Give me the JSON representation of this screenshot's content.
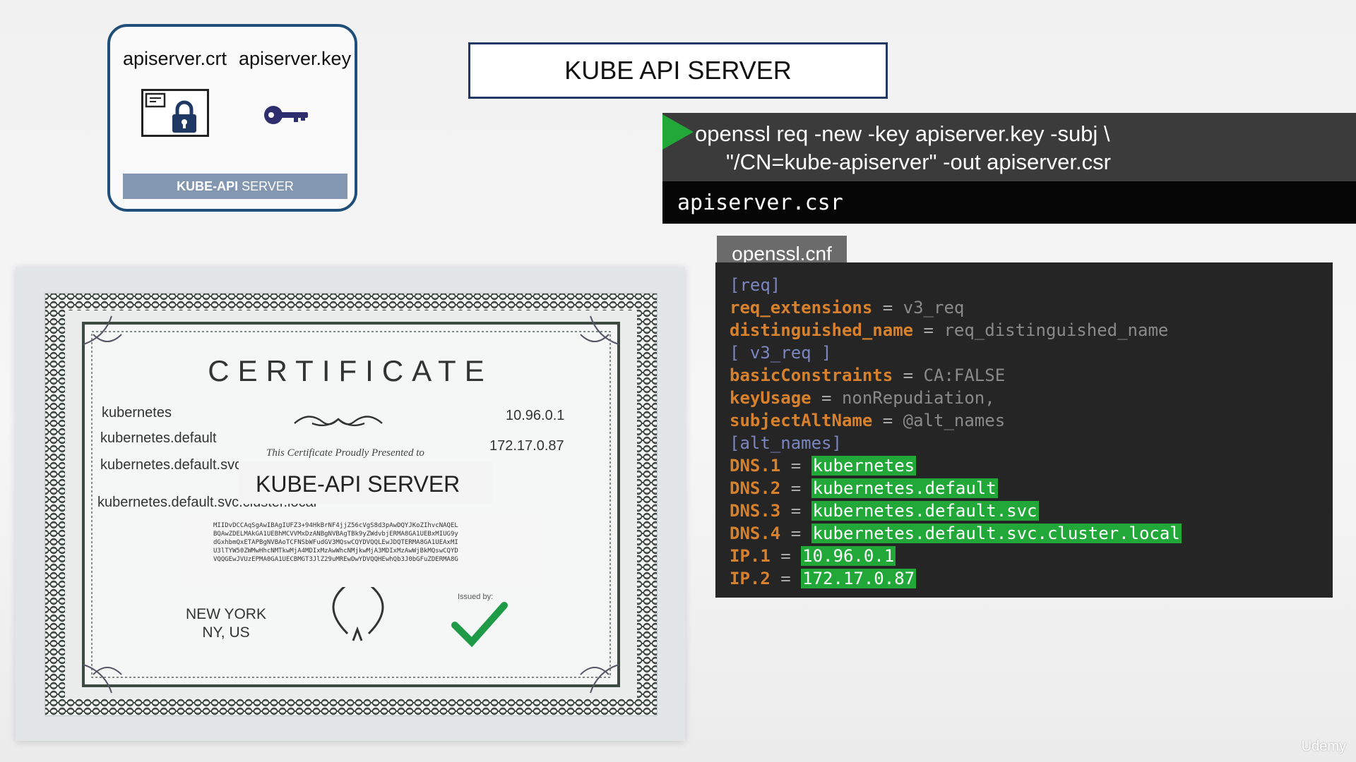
{
  "server_card": {
    "crt_label": "apiserver.crt",
    "key_label": "apiserver.key",
    "server_bold": "KUBE-API",
    "server_rest": " SERVER"
  },
  "title": "KUBE API SERVER",
  "command": {
    "line1": "openssl req -new -key apiserver.key -subj \\",
    "line2": "\"/CN=kube-apiserver\" -out apiserver.csr",
    "output": "apiserver.csr"
  },
  "config": {
    "tab_label": "openssl.cnf",
    "lines": [
      {
        "section": "[req]"
      },
      {
        "key": "req_extensions",
        "eq": " = ",
        "value": "v3_req"
      },
      {
        "plain": "distinguished_name",
        "eq": " = ",
        "value": "req_distinguished_name"
      },
      {
        "section": "[ v3_req ]"
      },
      {
        "key": "basicConstraints",
        "eq": " = ",
        "value": "CA:FALSE"
      },
      {
        "key": "keyUsage",
        "eq": " = ",
        "value": "nonRepudiation,"
      },
      {
        "key": "subjectAltName",
        "eq": " = ",
        "value": "@alt_names"
      },
      {
        "section": "[alt_names]"
      },
      {
        "key": "DNS.1",
        "eq": " = ",
        "hl": "kubernetes"
      },
      {
        "key": "DNS.2",
        "eq": " = ",
        "hl": "kubernetes.default"
      },
      {
        "key": "DNS.3",
        "eq": " = ",
        "hl": "kubernetes.default.svc"
      },
      {
        "key": "DNS.4",
        "eq": " = ",
        "hl": "kubernetes.default.svc.cluster.local"
      },
      {
        "key": "IP.1",
        "eq": " = ",
        "hl": "10.96.0.1"
      },
      {
        "key": "IP.2",
        "eq": " = ",
        "hl": "172.17.0.87"
      }
    ]
  },
  "certificate": {
    "title": "CERTIFICATE",
    "dns_names": [
      "kubernetes",
      "kubernetes.default",
      "kubernetes.default.svc",
      "kubernetes.default.svc.cluster.local"
    ],
    "ips": [
      "10.96.0.1",
      "172.17.0.87"
    ],
    "presented": "This Certificate Proudly Presented to",
    "name": "KUBE-API SERVER",
    "hash_lines": [
      "MIIDvDCCAqSgAwIBAgIUFZ3+94HkBrNF4jjZ56cVgS8d3pAwDQYJKoZIhvcNAQEL",
      "BQAwZDELMAkGA1UEBhMCVVMxDzANBgNVBAgTBk9yZWdvbjERMA8GA1UEBxMIUG9y",
      "dGxhbmQxETAPBgNVBAoTCFNSbWFudGV3MQswCQYDVQQLEwJDQTERMA8GA1UEAxMI",
      "U3lTYW50ZWMwHhcNMTkwMjA4MDIxMzAwWhcNMjkwMjA3MDIxMzAwWjBkMQswCQYD",
      "VQQGEwJVUzEPMA0GA1UECBMGT3JlZ29uMREwDwYDVQQHEwhQb3J0bGFuZDERMA8G"
    ],
    "issued_by": "Issued by:",
    "location_line1": "NEW YORK",
    "location_line2": "NY, US"
  },
  "brand": "Udemy",
  "colors": {
    "accent_green": "#21a838",
    "card_border": "#1f4e79",
    "config_key": "#d8812d",
    "config_section": "#7b86c0"
  },
  "icons": [
    "certificate-lock-icon",
    "key-icon",
    "play-icon",
    "laurel-icon",
    "checkmark-icon",
    "flourish-icon"
  ]
}
